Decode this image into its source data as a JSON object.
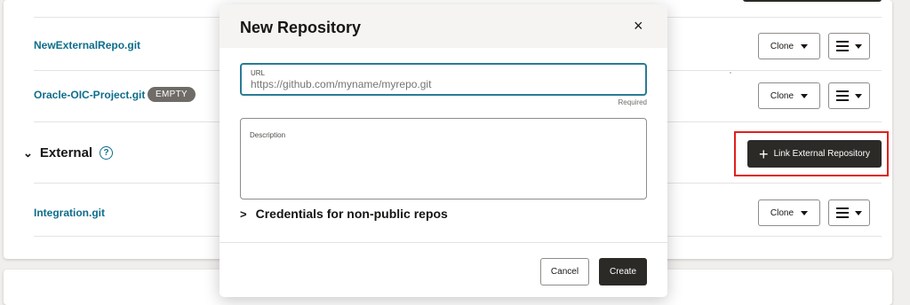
{
  "background_rows": [
    {
      "name": "NewExternalRepo.git",
      "clone_label": "Clone"
    },
    {
      "name": "Oracle-OIC-Project.git",
      "badge": "EMPTY",
      "clone_label": "Clone"
    },
    {
      "name": "Integration.git",
      "clone_label": "Clone"
    }
  ],
  "external_section": {
    "title": "External",
    "link_button_label": "Link External Repository"
  },
  "modal": {
    "title": "New Repository",
    "close_icon": "×",
    "url": {
      "label": "URL",
      "placeholder": "https://github.com/myname/myrepo.git",
      "value": "",
      "required_text": "Required"
    },
    "description": {
      "label": "Description",
      "value": ""
    },
    "credentials_label": "Credentials for non-public repos",
    "cancel_label": "Cancel",
    "create_label": "Create"
  },
  "colors": {
    "link": "#0e6d8b",
    "dark_button": "#2c2a27",
    "focus_border": "#2a7b95",
    "highlight": "#e0201c"
  },
  "icons": {
    "close": "close-icon",
    "chevron": "chevron-right-icon",
    "section_chevron": "chevron-down-icon",
    "help": "help-icon",
    "plus": "plus-icon",
    "menu": "hamburger-icon",
    "caret": "caret-down-icon"
  }
}
